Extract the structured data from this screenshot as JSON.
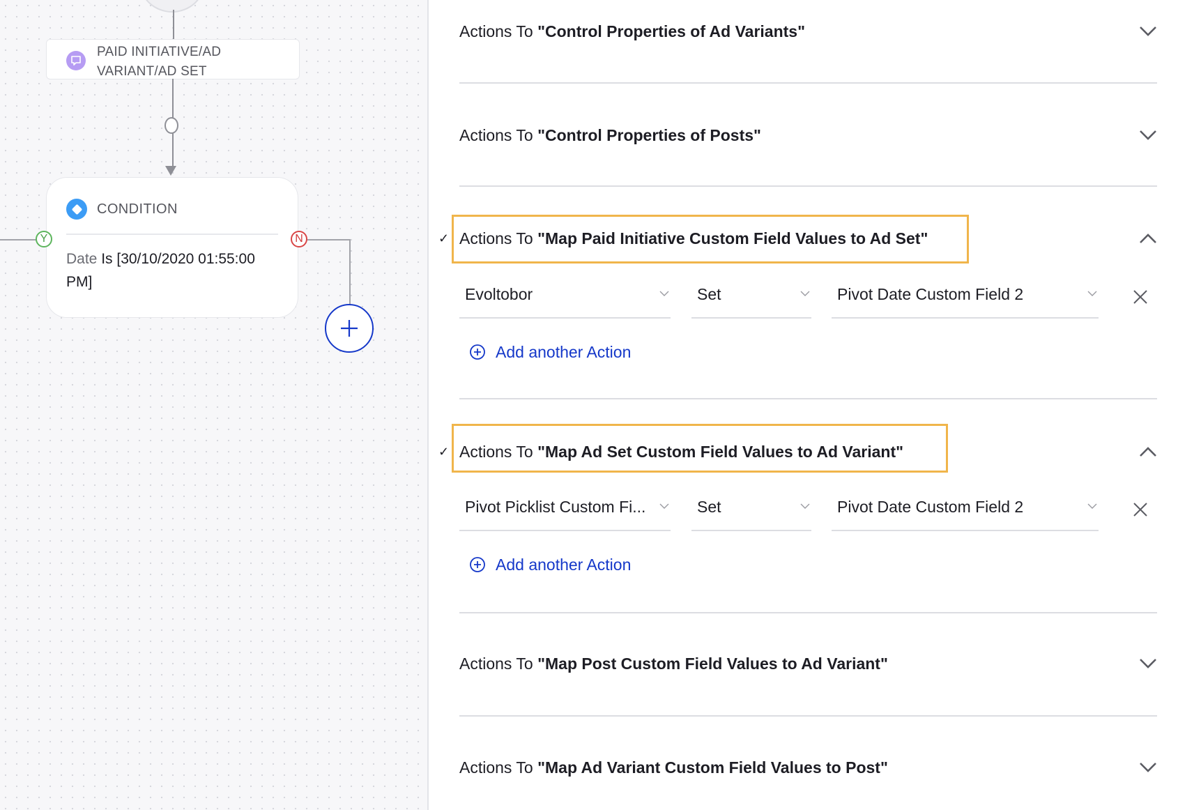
{
  "canvas": {
    "paid_node": {
      "icon": "chat-bubble-icon",
      "label_line1": "PAID INITIATIVE/AD",
      "label_line2": "VARIANT/AD SET",
      "icon_color": "#b69cf3"
    },
    "condition_node": {
      "icon": "diamond-icon",
      "title": "CONDITION",
      "field": "Date",
      "expression": " Is [30/10/2020 01:55:00 PM]",
      "icon_color": "#3c9cf5"
    },
    "yes_port": "Y",
    "no_port": "N",
    "add_node_icon": "plus-icon",
    "colors": {
      "yes": "#5db55d",
      "no": "#d94545",
      "add": "#1538c9"
    }
  },
  "panel": {
    "sections": [
      {
        "prefix": "Actions To ",
        "name": "\"Control Properties of Ad Variants\"",
        "expanded": false,
        "checked": false
      },
      {
        "prefix": "Actions To ",
        "name": "\"Control Properties of Posts\"",
        "expanded": false,
        "checked": false
      },
      {
        "prefix": "Actions To ",
        "name": "\"Map Paid Initiative Custom Field Values to Ad Set\"",
        "expanded": true,
        "checked": true,
        "highlighted": true,
        "actions": [
          {
            "field": "Evoltobor",
            "operator": "Set",
            "value": "Pivot Date Custom Field 2"
          }
        ],
        "add_label": "Add another Action"
      },
      {
        "prefix": "Actions To ",
        "name": "\"Map Ad Set Custom Field Values to Ad Variant\"",
        "expanded": true,
        "checked": true,
        "highlighted": true,
        "actions": [
          {
            "field": "Pivot Picklist Custom Fi...",
            "operator": "Set",
            "value": "Pivot Date Custom Field 2"
          }
        ],
        "add_label": "Add another Action"
      },
      {
        "prefix": "Actions To ",
        "name": "\"Map Post Custom Field Values to Ad Variant\"",
        "expanded": false,
        "checked": false
      },
      {
        "prefix": "Actions To ",
        "name": "\"Map Ad Variant Custom Field Values to Post\"",
        "expanded": false,
        "checked": false
      }
    ],
    "check_glyph": "✓",
    "colors": {
      "highlight": "#f0b54b",
      "link": "#1538c9"
    }
  }
}
